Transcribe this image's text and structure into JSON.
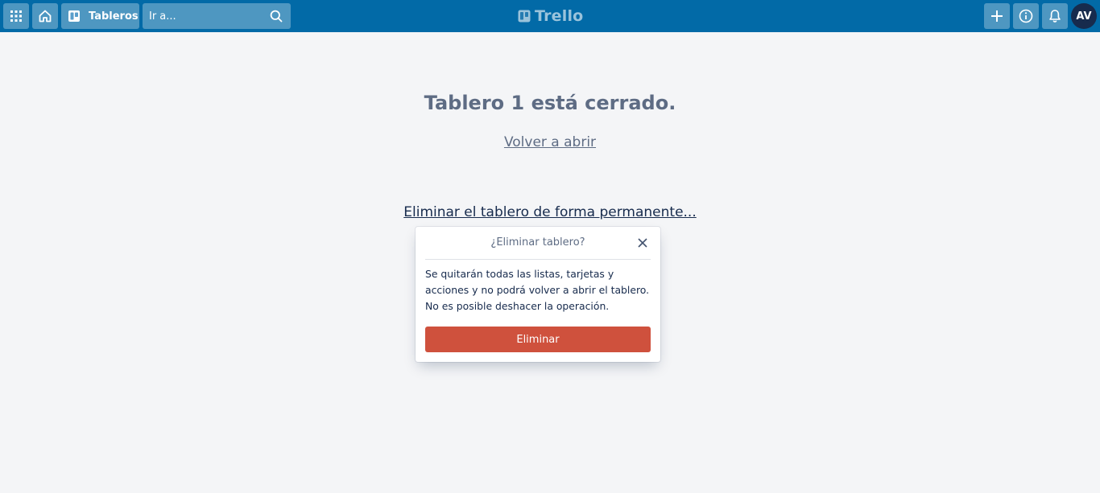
{
  "header": {
    "boards_label": "Tableros",
    "search_placeholder": "Ir a...",
    "logo_text": "Trello",
    "avatar_initials": "AV"
  },
  "main": {
    "closed_message": "Tablero 1 está cerrado.",
    "reopen_link": "Volver a abrir",
    "delete_link": "Eliminar el tablero de forma permanente..."
  },
  "popover": {
    "title": "¿Eliminar tablero?",
    "body": "Se quitarán todas las listas, tarjetas y acciones y no podrá volver a abrir el tablero. No es posible deshacer la operación.",
    "button_label": "Eliminar"
  },
  "colors": {
    "header_bg": "#026aa7",
    "page_bg": "#f4f5f7",
    "danger": "#cf513d",
    "avatar_bg": "#172b4d"
  }
}
